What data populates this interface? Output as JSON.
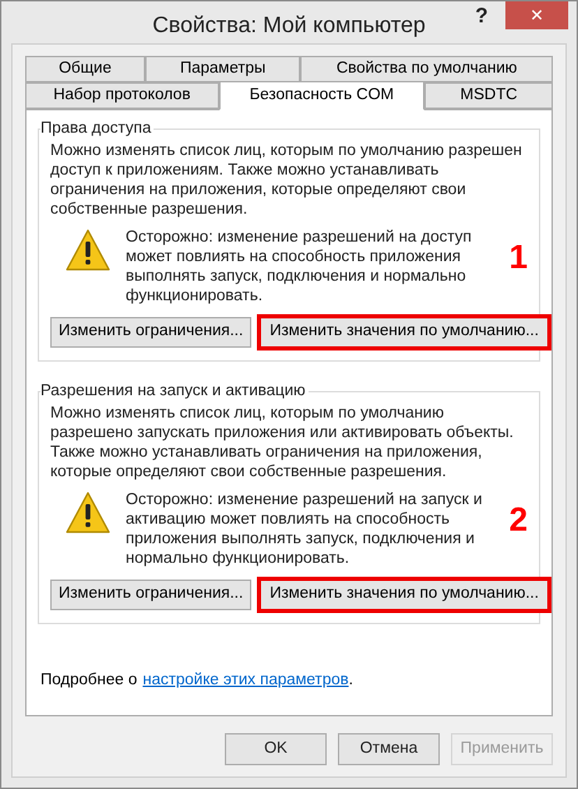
{
  "window": {
    "title": "Свойства: Мой компьютер",
    "help": "?",
    "close": "✕"
  },
  "tab_rows": [
    {
      "tabs": [
        {
          "label": "Общие",
          "selected": false
        },
        {
          "label": "Параметры",
          "selected": false
        },
        {
          "label": "Свойства по умолчанию",
          "selected": false
        }
      ]
    },
    {
      "tabs": [
        {
          "label": "Набор протоколов",
          "selected": false
        },
        {
          "label": "Безопасность COM",
          "selected": true
        },
        {
          "label": "MSDTC",
          "selected": false
        }
      ]
    }
  ],
  "groups": [
    {
      "title": "Права доступа",
      "description": "Можно изменять список лиц, которым по умолчанию разрешен доступ к приложениям. Также можно устанавливать ограничения на приложения, которые определяют свои собственные разрешения.",
      "warning": "Осторожно: изменение разрешений на доступ может повлиять на способность приложения выполнять запуск, подключения и нормально функционировать.",
      "annotation": "1",
      "buttons": [
        {
          "label": "Изменить ограничения...",
          "highlighted": false
        },
        {
          "label": "Изменить значения по умолчанию...",
          "highlighted": true
        }
      ]
    },
    {
      "title": "Разрешения на запуск и активацию",
      "description": "Можно изменять список лиц, которым по умолчанию разрешено запускать приложения или активировать объекты. Также можно устанавливать ограничения на приложения, которые определяют свои собственные разрешения.",
      "warning": "Осторожно: изменение разрешений на запуск и активацию может повлиять на способность приложения выполнять запуск, подключения и нормально функционировать.",
      "annotation": "2",
      "buttons": [
        {
          "label": "Изменить ограничения...",
          "highlighted": false
        },
        {
          "label": "Изменить значения по умолчанию...",
          "highlighted": true
        }
      ]
    }
  ],
  "footer": {
    "text": "Подробнее о",
    "link": "настройке этих параметров",
    "suffix": "."
  },
  "buttons": [
    {
      "label": "OK",
      "disabled": false
    },
    {
      "label": "Отмена",
      "disabled": false
    },
    {
      "label": "Применить",
      "disabled": true
    }
  ]
}
